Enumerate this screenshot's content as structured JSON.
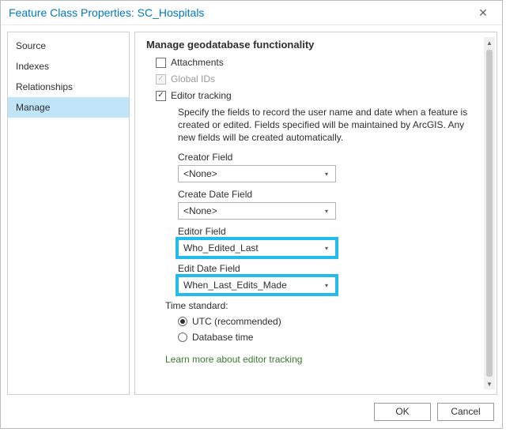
{
  "window": {
    "title": "Feature Class Properties: SC_Hospitals"
  },
  "sidebar": {
    "items": [
      "Source",
      "Indexes",
      "Relationships",
      "Manage"
    ],
    "selectedIndex": 3
  },
  "main": {
    "heading": "Manage geodatabase functionality",
    "attachments_label": "Attachments",
    "globalids_label": "Global IDs",
    "editor_tracking_label": "Editor tracking",
    "description": "Specify the fields to record the user name and date when a feature is created or edited. Fields specified will be maintained by ArcGIS. Any new fields will be created automatically.",
    "creator_field_label": "Creator Field",
    "creator_field_value": "<None>",
    "create_date_label": "Create Date Field",
    "create_date_value": "<None>",
    "editor_field_label": "Editor Field",
    "editor_field_value": "Who_Edited_Last",
    "edit_date_label": "Edit Date Field",
    "edit_date_value": "When_Last_Edits_Made",
    "time_standard_label": "Time standard:",
    "radio_utc": "UTC (recommended)",
    "radio_db": "Database time",
    "learn_link": "Learn more about editor tracking"
  },
  "footer": {
    "ok": "OK",
    "cancel": "Cancel"
  }
}
